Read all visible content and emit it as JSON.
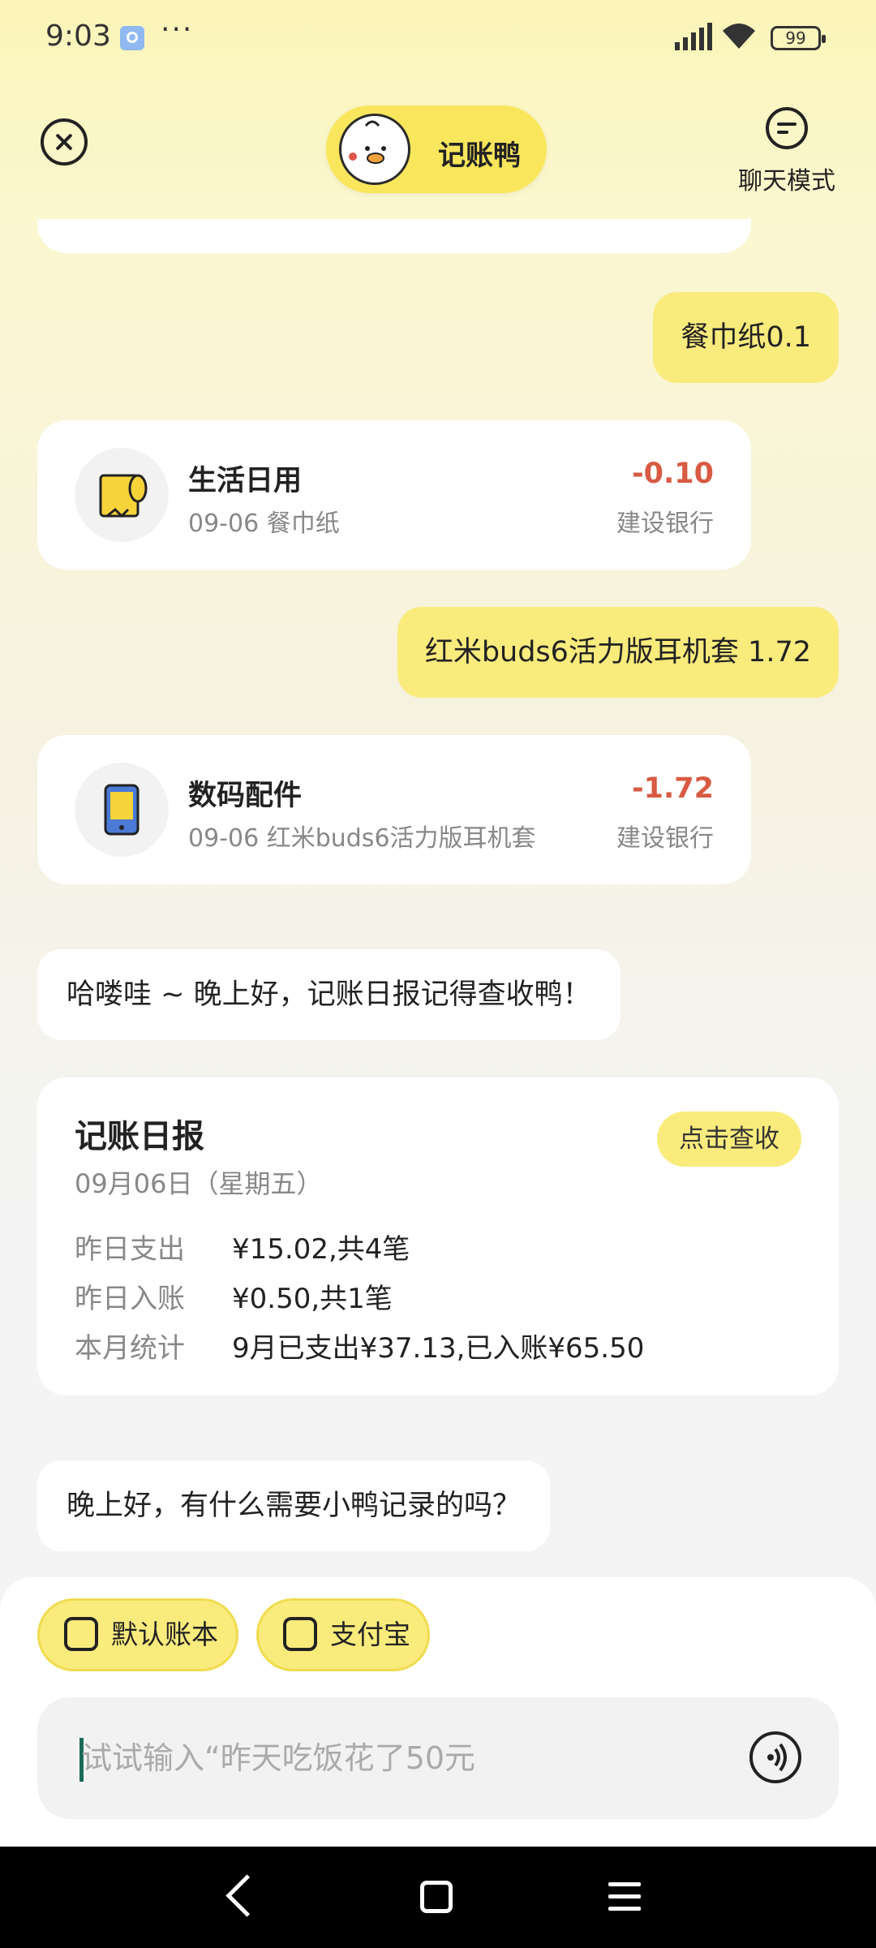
{
  "status_bar": {
    "time": "9:03",
    "more": "···",
    "battery": "99"
  },
  "header": {
    "title": "记账鸭",
    "chat_mode_label": "聊天模式"
  },
  "messages": {
    "user1": "餐巾纸0.1",
    "tx1": {
      "category": "生活日用",
      "desc": "09-06 餐巾纸",
      "amount": "-0.10",
      "bank": "建设银行"
    },
    "user2": "红米buds6活力版耳机套 1.72",
    "tx2": {
      "category": "数码配件",
      "desc": "09-06 红米buds6活力版耳机套",
      "amount": "-1.72",
      "bank": "建设银行"
    },
    "bot1": "哈喽哇 ~ 晚上好，记账日报记得查收鸭！",
    "report": {
      "title": "记账日报",
      "date": "09月06日（星期五）",
      "check_button": "点击查收",
      "rows": [
        {
          "key": "昨日支出",
          "value": "¥15.02,共4笔"
        },
        {
          "key": "昨日入账",
          "value": "¥0.50,共1笔"
        },
        {
          "key": "本月统计",
          "value": "9月已支出¥37.13,已入账¥65.50"
        }
      ]
    },
    "bot2": "晚上好，有什么需要小鸭记录的吗？"
  },
  "bottom": {
    "chips": [
      {
        "label": "默认账本",
        "icon": "yuan-wallet-icon"
      },
      {
        "label": "支付宝",
        "icon": "wallet-icon"
      }
    ],
    "input_placeholder": "试试输入“昨天吃饭花了50元"
  },
  "colors": {
    "accent_yellow": "#faeb7d",
    "amount_red": "#d85a42"
  }
}
